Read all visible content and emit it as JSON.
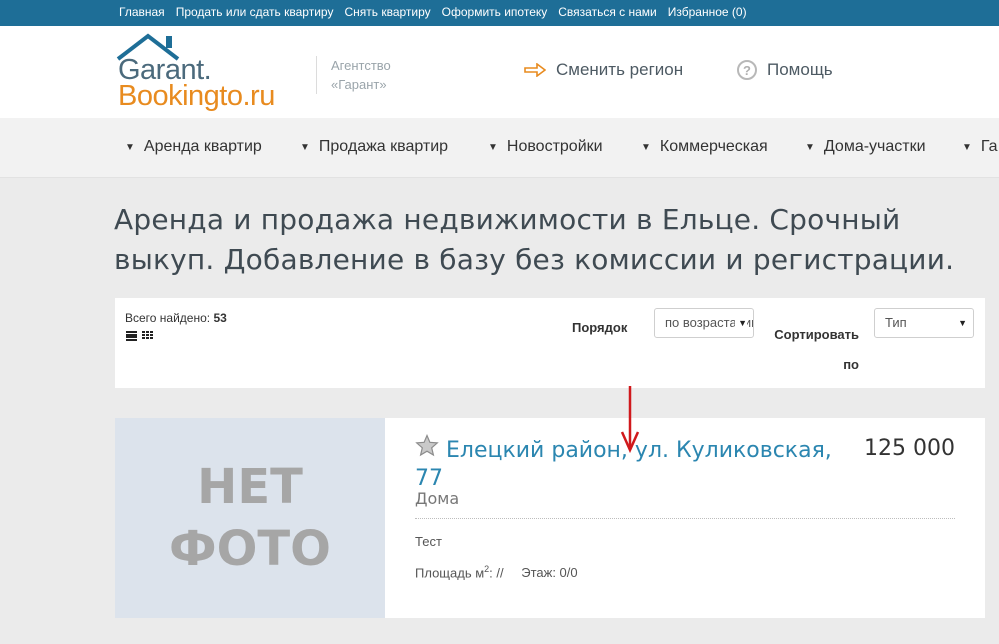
{
  "topnav": {
    "items": [
      {
        "label": "Главная"
      },
      {
        "label": "Продать или сдать квартиру"
      },
      {
        "label": "Снять квартиру"
      },
      {
        "label": "Оформить ипотеку"
      },
      {
        "label": "Связаться с нами"
      },
      {
        "label": "Избранное (0)"
      }
    ]
  },
  "header": {
    "logo_line1": "Garant.",
    "logo_line2": "Bookingto.ru",
    "agency_line1": "Агентство",
    "agency_line2": "«Гарант»",
    "region_label": "Сменить регион",
    "help_label": "Помощь",
    "icons": {
      "region": "arrow-right-icon",
      "help": "question-circle-icon"
    }
  },
  "mainnav": {
    "items": [
      {
        "label": "Аренда квартир"
      },
      {
        "label": "Продажа квартир"
      },
      {
        "label": "Новостройки"
      },
      {
        "label": "Коммерческая"
      },
      {
        "label": "Дома-участки"
      },
      {
        "label": "Га"
      }
    ]
  },
  "page": {
    "title": "Аренда и продажа недвижимости в Ельце. Срочный выкуп. Добавление в базу без комиссии и регистрации."
  },
  "filters": {
    "found_label": "Всего найдено:",
    "found_count": "53",
    "order_label": "Порядок",
    "order_value": "по возрастанию",
    "sort_label": "Сортировать по",
    "sort_value": "Тип"
  },
  "listing": {
    "no_photo_line1": "НЕТ",
    "no_photo_line2": "ФОТО",
    "title": "Елецкий район, ул. Куликовская, 77",
    "price": "125 000",
    "type": "Дома",
    "description": "Тест",
    "area_label": "Площадь м",
    "area_sup": "2",
    "area_value": ": //",
    "floor_text": "Этаж: 0/0"
  },
  "colors": {
    "topbar": "#1e6e97",
    "link": "#2b86b0",
    "logo_orange": "#e88b1f",
    "logo_slate": "#4b6a7c",
    "annotation": "#d0191c"
  }
}
